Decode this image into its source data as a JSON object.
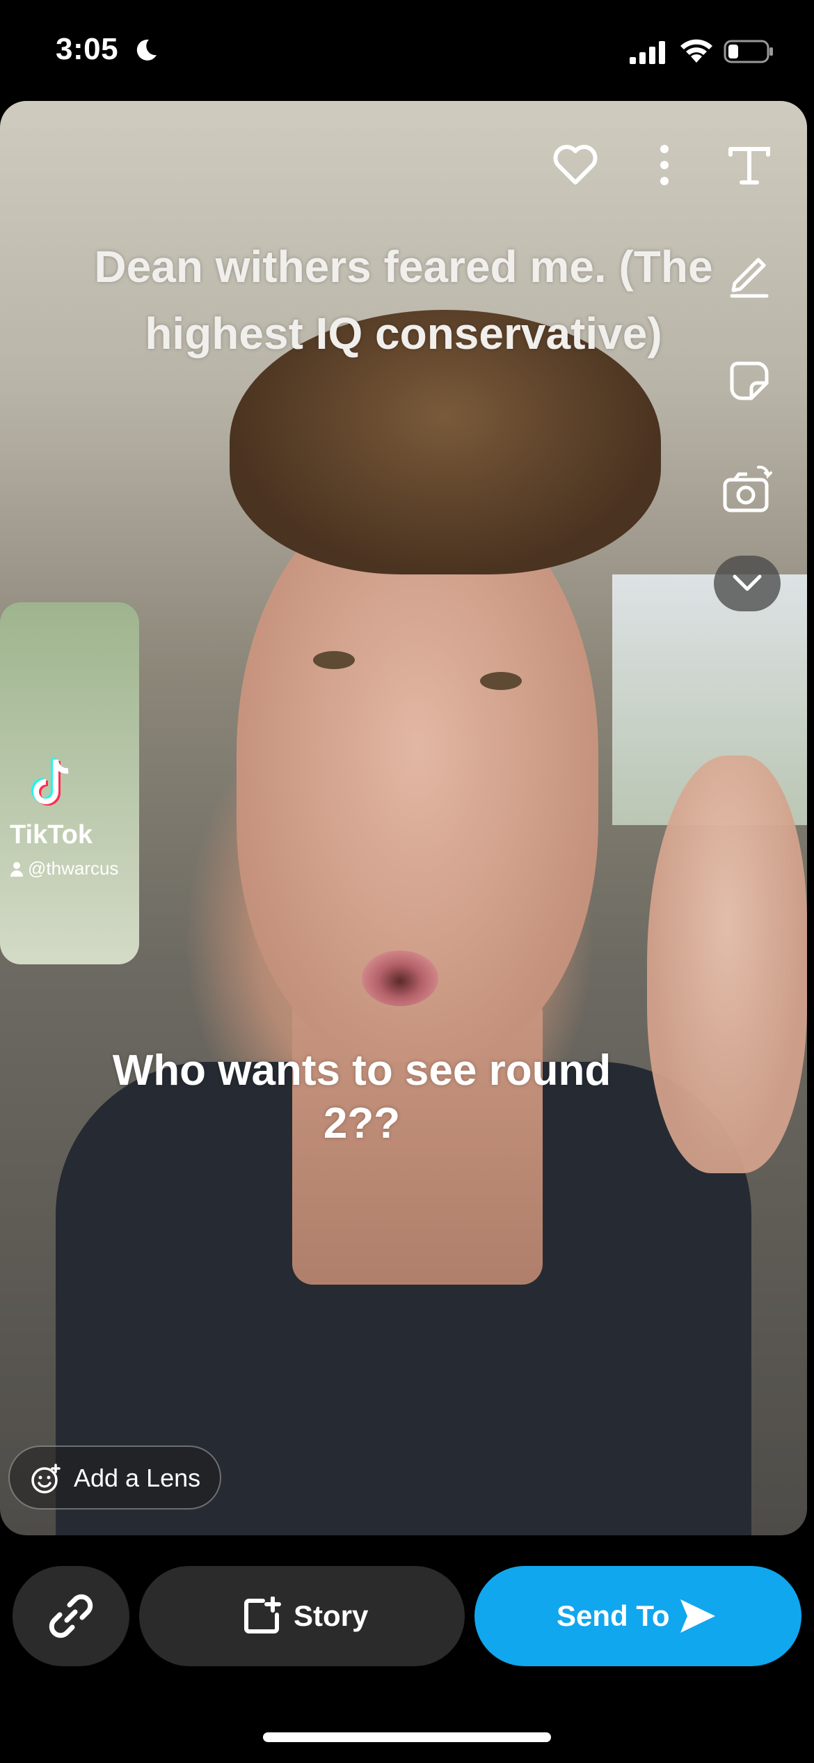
{
  "status_bar": {
    "time": "3:05",
    "icons": [
      "moon-icon",
      "signal-icon",
      "wifi-icon",
      "battery-icon"
    ]
  },
  "media": {
    "caption_top": "Dean withers feared me. (The highest IQ conservative)",
    "caption_bottom": "Who wants to see round 2??",
    "watermark": {
      "brand": "TikTok",
      "handle": "@thwarcus"
    }
  },
  "tools": [
    "heart-icon",
    "more-options-icon",
    "text-tool-icon",
    "pencil-icon",
    "sticker-icon",
    "camera-flip-icon",
    "chevron-down-icon"
  ],
  "lens_chip": {
    "label": "Add a Lens"
  },
  "bottom_bar": {
    "story_label": "Story",
    "send_label": "Send To"
  },
  "colors": {
    "send_button": "#10a7ee",
    "dark_button": "#2b2b2b",
    "background": "#000000"
  }
}
